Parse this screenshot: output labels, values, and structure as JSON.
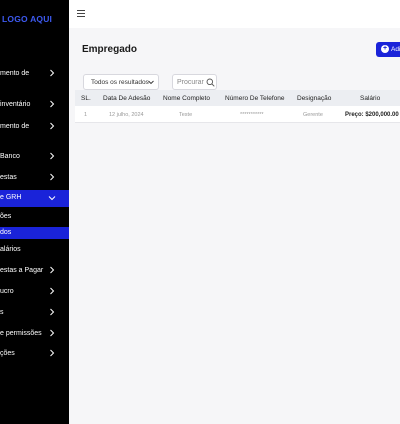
{
  "sidebar": {
    "logo": "LOGO AQUI",
    "items": [
      {
        "label": "mento de"
      },
      {
        "label": "inventário"
      },
      {
        "label": "mento de"
      },
      {
        "label": "Banco"
      },
      {
        "label": "estas"
      },
      {
        "label": "e GRH"
      },
      {
        "label": "estas a Pagar"
      },
      {
        "label": "ucro"
      },
      {
        "label": "s"
      },
      {
        "label": "e permissões"
      },
      {
        "label": "ções"
      }
    ],
    "subitems": [
      {
        "label": "ões"
      },
      {
        "label": "dos"
      },
      {
        "label": "alários"
      }
    ]
  },
  "main": {
    "title": "Empregado",
    "add_button": "Adic",
    "filter": {
      "selected": "Todos os resultados"
    },
    "search": {
      "placeholder": "Procurar"
    },
    "table": {
      "headers": [
        "SL.",
        "Data De Adesão",
        "Nome Completo",
        "Número De Telefone",
        "Designação",
        "Salário"
      ],
      "rows": [
        {
          "sl": "1",
          "date": "12 julho, 2024",
          "name": "Teste",
          "phone": "***********",
          "designation": "Gerente",
          "salary": "Preço: $200,000.00"
        }
      ]
    }
  },
  "colors": {
    "accent": "#1a23d9",
    "logo": "#3d5af1",
    "sidebar_bg": "#000000"
  },
  "icons": [
    "hamburger-icon",
    "chevron-right-icon",
    "chevron-down-icon",
    "plus-circle-icon",
    "search-icon"
  ]
}
